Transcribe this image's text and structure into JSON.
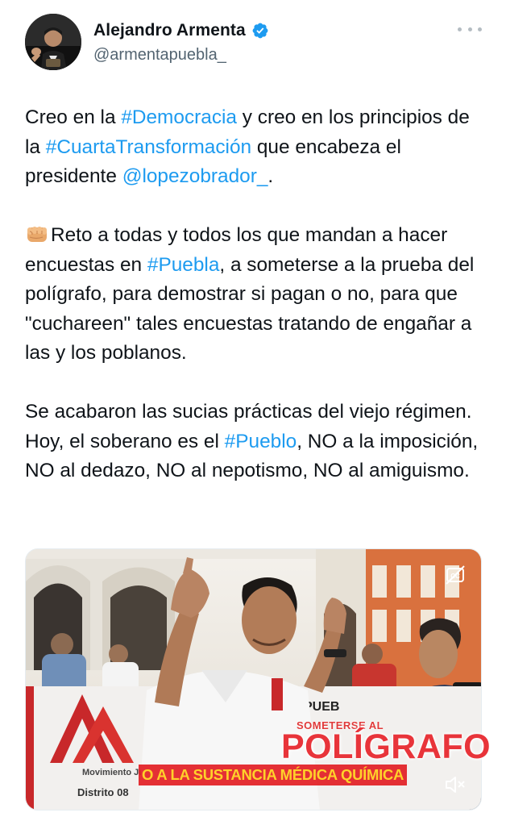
{
  "author": {
    "name": "Alejandro Armenta",
    "handle": "@armentapuebla_",
    "verified_icon": "verified-badge-icon"
  },
  "tweet": {
    "p1": {
      "t1": "Creo en la ",
      "h1": "#Democracia",
      "t2": " y creo en los principios de la ",
      "h2": "#CuartaTransformación",
      "t3": " que encabeza el presidente ",
      "m1": "@lopezobrador_",
      "t4": "."
    },
    "p2": {
      "emoji": "fist-emoji",
      "t1": "Reto a todas y todos los que mandan a hacer encuestas en ",
      "h1": "#Puebla",
      "t2": ", a someterse a la prueba del polígrafo, para demostrar si pagan o no, para que \"cuchareen\" tales encuestas tratando de engañar a las y los poblanos."
    },
    "p3": {
      "t1": "Se acabaron las sucias prácticas del viejo régimen. Hoy, el soberano es el ",
      "h1": "#Pueblo",
      "t2": ", NO a la imposición, NO al dedazo, NO al nepotismo, NO al amiguismo."
    }
  },
  "video": {
    "overlay_small": "SOMETERSE AL",
    "overlay_big": "POLÍGRAFO",
    "caption": "O A LA SUSTANCIA MÉDICA QUÍMICA",
    "banner_texts": [
      "Movimiento Juvenil Ar",
      "Distrito 08",
      "PUEB"
    ],
    "icons": [
      "captions-icon",
      "mute-icon"
    ]
  },
  "colors": {
    "link": "#1d9bf0",
    "text": "#0f1419",
    "secondary": "#536471",
    "verified": "#1d9bf0"
  }
}
